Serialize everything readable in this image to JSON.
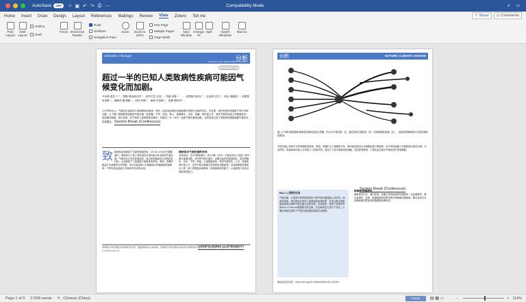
{
  "window": {
    "title": "Compatibility Mode",
    "autosave_label": "AutoSave",
    "autosave_state": "OFF",
    "traffic_colors": [
      "#ff5f57",
      "#febc2e",
      "#28c840"
    ]
  },
  "menu": {
    "tabs": [
      "Home",
      "Insert",
      "Draw",
      "Design",
      "Layout",
      "References",
      "Mailings",
      "Review",
      "View",
      "Zotero",
      "Tell me"
    ],
    "active": "View",
    "share_label": "Share",
    "comments_label": "Comments"
  },
  "ribbon": {
    "print_layout": "Print Layout",
    "web_layout": "Web Layout",
    "outline": "Outline",
    "draft": "Draft",
    "focus": "Focus",
    "immersive_reader": "Immersive Reader",
    "ruler": "Ruler",
    "gridlines": "Gridlines",
    "navigation_pane": "Navigation Pane",
    "zoom": "Zoom",
    "zoom_100": "Zoom to 100%",
    "one_page": "One Page",
    "multiple_pages": "Multiple Pages",
    "page_width": "Page Width",
    "new_window": "New Window",
    "arrange_all": "Arrange All",
    "split": "Split",
    "switch_windows": "Switch Windows",
    "macros": "Macros"
  },
  "page1": {
    "journal_logo": "climatic change",
    "section_label": "分析",
    "doi": "https://doi.org/10.1038/s41558-022-01426-1",
    "check_updates": "Check for updates",
    "title": "超过一半的已知人类致病性疾病可能因气候变化而加剧。",
    "authors": "卡米洛·莫拉 ◎ ¹ ，泰勒·麦克纳马拉 ¹ ，伊莎贝拉·沃克 ¹ ，杰森·米勒 ¹ ，...... 克里斯·特劳尔 ² ，吉尼斯·达托 ² ，阿比·胡塞因 ² ，安德鲁·米查斯 ¹ ，弗朗辛·德·朗斯 ¹ ，伯林·布朗 ¹ ，索菲·史密斯 ¹ ，安娜·德布茨 ¹",
    "abstract": "人们早就认为，气候变化会影响人类病原体的疾病。然而，目前对影响的全面程度仍然缺乏全面的评估。在这里，我们系统性地搜索了同行评审文献，以了解人类病原体疾病因气候灾害（如变暖、干旱、热浪、野火、极端降水、洪水、风暴、海平面上升、海洋气候变化和土地覆盖变化）而加剧的程度。我们发现，在已知的人类病原体疾病中，有超过一半（58%）会因气候灾害而加剧。这些发现凸显了采取积极措施减缓气候变化的重要性。",
    "section_break": "Section Break (Continuous)",
    "col1": "致病性疾病造成了沉重的健康负担。COVID-19大流行提醒我们，病原体与人类之间的相互作用可能对社会造成严重后果。气候变化正在改变病原体、宿主和传播途径之间的相互作用，从而增加了人类暴露于病原体的风险。例如，变暖可能会扩大病媒的分布范围，洪水可能会使人们接触到水传播疾病的病原体，干旱可能会迫使人们使用不安全的水源。",
    "col2_head": "病原体与气候灾害的关系",
    "col2": "总体而言，在375种疾病中，有218种（58%）已被证实至少会因一种气候灾害而加剧。在所有气候灾害中，变暖与最多的疾病相关，其次是降水、洪水、干旱、风暴、土地覆盖变化、海洋气候变化、火灾、热浪和海平面上升。这些气候灾害通过多种途径加剧疾病，包括使病原体更接近人类，使人类更接近病原体，增强病原体的能力，以及削弱人类应对病原体的能力。",
    "footnotes": "¹夏威夷大学马诺阿分校地理与环境系，美国夏威夷州火奴鲁鲁。²夏威夷大学马诺阿分校海洋与地球科学与技术学院，美国夏威夷州火奴鲁鲁。电子邮箱：cmora@hawaii.edu",
    "section_break_2": "Section Break (Continuous)"
  },
  "page2": {
    "section_label": "分析",
    "journal_name": "NATURE CLIMATE CHANGE",
    "figure_caption": "图 1 | 气候灾害加剧的病原性疾病的途径示意图。所示为气候灾害（左）通过四种主要途径（中）影响病原性疾病（右）。连接线的粗细表示已报告案例的数量。",
    "body_text": "气候灾害以多种方式影响病原性疾病。例如，变暖扩大了病媒的分布，降水增加和洪水为病媒创造了繁殖地，而干旱则迫使人们使用受污染的水源。与此同时，风暴和海平面上升导致人口流离失所，增加了人类与病原体的接触。这些发现表明，人类社会在面对气候变化时非常脆弱。",
    "box_title": "Box 1 | 研究方法",
    "box_text": "气候灾害：与温室气体排放相关的十种气候灾害被纳入本研究。病原体疾病：我们使用已知的人类病原体疾病列表，并在文献中搜索每种疾病与每种气候灾害之间的关联。系统检索：检索了谷歌学术和Web of Science数据库中的文献，并对每篇论文进行了评估，以确定其是否提供了气候灾害加剧疾病的实证案例。",
    "methods_head": "疾病的传播途径",
    "methods_text": "病原体的分布：我们发现，变暖与多种疾病的传播相关，包括登革热、基孔肯雅热、疟疾、莱姆病和西尼罗河病毒等病媒传播疾病。降水变化与水传播疾病如霍乱和钩端螺旋体病相关。",
    "section_break": "Section Break (Continuous)",
    "bottom_note": "阅读全文请访问：https://doi.org/10.1038/s41558-022-01426-1"
  },
  "status": {
    "page": "Page 1 of 9",
    "words": "17306 words",
    "language": "Chinese (China)",
    "focus": "Focus",
    "zoom": "114%",
    "zoom_level_pct": 54
  }
}
